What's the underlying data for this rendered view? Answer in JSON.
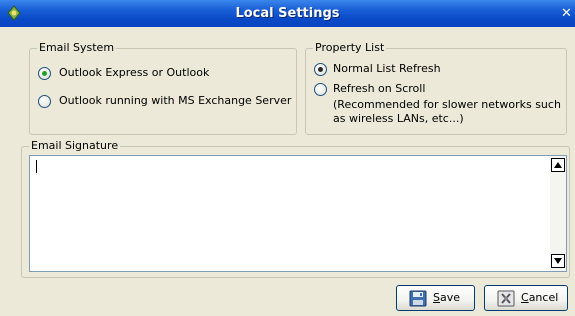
{
  "window": {
    "title": "Local Settings",
    "close_glyph": "✕"
  },
  "email_system": {
    "legend": "Email System",
    "options": [
      {
        "label": "Outlook Express or Outlook",
        "selected": true
      },
      {
        "label": "Outlook running with MS Exchange Server",
        "selected": false
      }
    ]
  },
  "property_list": {
    "legend": "Property List",
    "options": [
      {
        "label": "Normal List Refresh",
        "selected": true
      },
      {
        "label": "Refresh on Scroll",
        "selected": false
      }
    ],
    "note_line1": "(Recommended for slower networks such",
    "note_line2": "as wireless LANs, etc...)"
  },
  "email_signature": {
    "legend": "Email Signature",
    "value": ""
  },
  "buttons": {
    "save_label": "Save",
    "cancel_label": "Cancel"
  },
  "colors": {
    "titlebar": "#0a4ac8",
    "dialog_bg": "#ece9d8",
    "radio_selected_green": "#21a121"
  },
  "icons": {
    "app": "app-icon",
    "save": "floppy-disk-icon",
    "cancel": "cancel-icon"
  }
}
